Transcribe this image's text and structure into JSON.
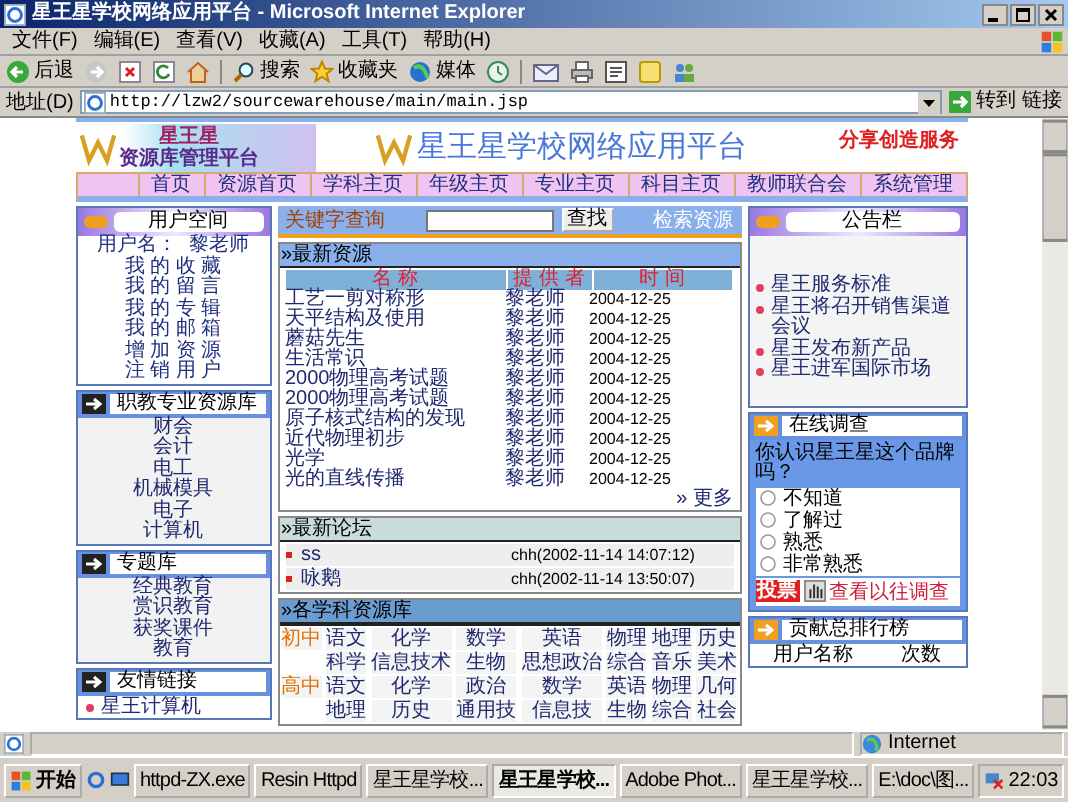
{
  "window": {
    "title": "星王星学校网络应用平台 - Microsoft Internet Explorer"
  },
  "menu": [
    "文件(F)",
    "编辑(E)",
    "查看(V)",
    "收藏(A)",
    "工具(T)",
    "帮助(H)"
  ],
  "toolbar": {
    "back": "后退",
    "search": "搜索",
    "favorites": "收藏夹",
    "media": "媒体"
  },
  "address": {
    "label": "地址(D)",
    "value": "http://lzw2/sourcewarehouse/main/main.jsp",
    "go": "转到",
    "links": "链接"
  },
  "banner": {
    "logo_title": "星王星",
    "logo_subtitle": "资源库管理平台",
    "site_title": "星王星学校网络应用平台",
    "slogan": "分享创造服务"
  },
  "nav": [
    "首页",
    "资源首页",
    "学科主页",
    "年级主页",
    "专业主页",
    "科目主页",
    "教师联合会",
    "系统管理"
  ],
  "user_space": {
    "title": "用户空间",
    "username_label": "用户名：",
    "username": "黎老师",
    "links": [
      "我 的 收 藏",
      "我 的 留 言",
      "我 的 专 辑",
      "我 的 邮 箱",
      "增 加 资 源",
      "注 销 用 户"
    ]
  },
  "vocational": {
    "title": "职教专业资源库",
    "items": [
      "财会",
      "会计",
      "电工",
      "机械模具",
      "电子",
      "计算机"
    ]
  },
  "topics": {
    "title": "专题库",
    "items": [
      "经典教育",
      "赏识教育",
      "获奖课件",
      "教育"
    ]
  },
  "friend_links": {
    "title": "友情链接",
    "items": [
      "星王计算机"
    ]
  },
  "search": {
    "label": "关键字查询",
    "button": "查找",
    "advanced": "检索资源"
  },
  "latest_resources": {
    "title": "»最新资源",
    "columns": [
      "名 称",
      "提 供 者",
      "时 间"
    ],
    "more": "» 更多",
    "rows": [
      {
        "name": "工艺一剪对称形",
        "provider": "黎老师",
        "date": "2004-12-25"
      },
      {
        "name": "天平结构及使用",
        "provider": "黎老师",
        "date": "2004-12-25"
      },
      {
        "name": "蘑菇先生",
        "provider": "黎老师",
        "date": "2004-12-25"
      },
      {
        "name": "生活常识",
        "provider": "黎老师",
        "date": "2004-12-25"
      },
      {
        "name": "2000物理高考试题",
        "provider": "黎老师",
        "date": "2004-12-25"
      },
      {
        "name": "2000物理高考试题",
        "provider": "黎老师",
        "date": "2004-12-25"
      },
      {
        "name": "原子核式结构的发现",
        "provider": "黎老师",
        "date": "2004-12-25"
      },
      {
        "name": "近代物理初步",
        "provider": "黎老师",
        "date": "2004-12-25"
      },
      {
        "name": "光学",
        "provider": "黎老师",
        "date": "2004-12-25"
      },
      {
        "name": "光的直线传播",
        "provider": "黎老师",
        "date": "2004-12-25"
      }
    ]
  },
  "forum": {
    "title": "»最新论坛",
    "posts": [
      {
        "title": "ss",
        "meta": "chh(2002-11-14 14:07:12)"
      },
      {
        "title": "咏鹅",
        "meta": "chh(2002-11-14 13:50:07)"
      }
    ]
  },
  "subjects": {
    "title": "»各学科资源库",
    "rows": [
      {
        "level": "初中",
        "subjects": [
          "语文",
          "化学",
          "数学",
          "英语",
          "物理",
          "地理",
          "历史"
        ]
      },
      {
        "subjects": [
          "科学",
          "信息技术",
          "生物",
          "思想政治",
          "综合",
          "音乐",
          "美术"
        ]
      },
      {
        "level": "高中",
        "subjects": [
          "语文",
          "化学",
          "政治",
          "数学",
          "英语",
          "物理",
          "几何"
        ]
      },
      {
        "subjects": [
          "地理",
          "历史",
          "通用技",
          "信息技",
          "生物",
          "综合",
          "社会"
        ]
      }
    ]
  },
  "bulletin": {
    "title": "公告栏",
    "items": [
      "星王服务标准",
      "星王将召开销售渠道会议",
      "星王发布新产品",
      "星王进军国际市场"
    ]
  },
  "survey": {
    "title": "在线调查",
    "question": "你认识星王星这个品牌吗？",
    "options": [
      {
        "label": "不知道",
        "selected": false
      },
      {
        "label": "了解过",
        "selected": false
      },
      {
        "label": "熟悉",
        "selected": false
      },
      {
        "label": "非常熟悉",
        "selected": false
      }
    ],
    "vote": "投票",
    "history": "查看以往调查"
  },
  "ranking": {
    "title": "贡献总排行榜",
    "columns": [
      "用户名称",
      "次数"
    ]
  },
  "status_bar": {
    "zone": "Internet"
  },
  "taskbar": {
    "start": "开始",
    "clock": "22:03",
    "tasks": [
      {
        "label": "httpd-ZX.exe",
        "selected": false
      },
      {
        "label": "Resin Httpd",
        "selected": false
      },
      {
        "label": "星王星学校...",
        "selected": false
      },
      {
        "label": "星王星学校...",
        "selected": true
      },
      {
        "label": "Adobe Phot...",
        "selected": false
      },
      {
        "label": "星王星学校...",
        "selected": false
      },
      {
        "label": "E:\\doc\\图...",
        "selected": false
      }
    ]
  }
}
